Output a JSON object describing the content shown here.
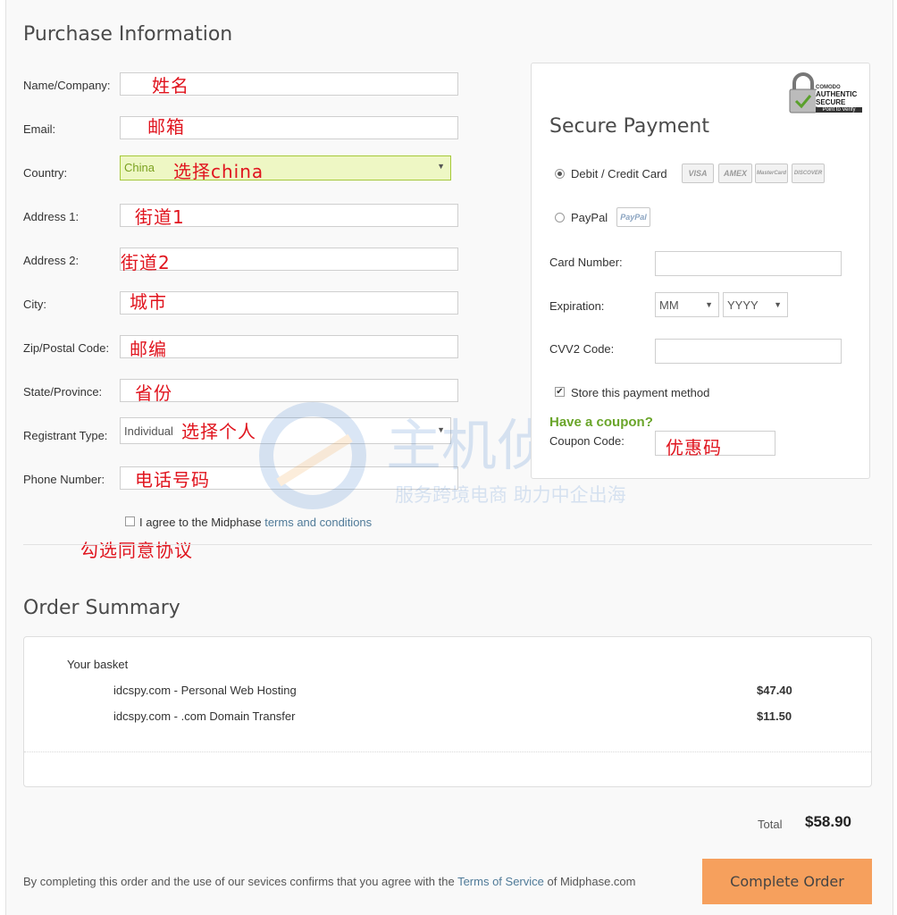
{
  "purchase": {
    "title": "Purchase Information",
    "fields": [
      {
        "label": "Name/Company:",
        "note": "姓名"
      },
      {
        "label": "Email:",
        "note": "邮箱"
      },
      {
        "label": "Country:",
        "value": "China",
        "note": "选择china"
      },
      {
        "label": "Address 1:",
        "note": "街道1"
      },
      {
        "label": "Address 2:",
        "note": "街道2"
      },
      {
        "label": "City:",
        "note": "城市"
      },
      {
        "label": "Zip/Postal Code:",
        "note": "邮编"
      },
      {
        "label": "State/Province:",
        "note": "省份"
      },
      {
        "label": "Registrant Type:",
        "value": "Individual",
        "note": "选择个人"
      },
      {
        "label": "Phone Number:",
        "note": "电话号码"
      }
    ],
    "agree_text": "I agree to the Midphase ",
    "agree_link": "terms and conditions",
    "agree_note": "勾选同意协议"
  },
  "payment": {
    "badge_top": "COMODO",
    "badge_main": "AUTHENTIC SECURE",
    "badge_sub": "Point to Verify",
    "title": "Secure Payment",
    "option_card": "Debit / Credit Card",
    "card_logos": [
      "VISA",
      "AMEX",
      "MasterCard",
      "DISCOVER"
    ],
    "option_paypal": "PayPal",
    "paypal_logo": "PayPal",
    "card_number_label": "Card Number:",
    "expiration_label": "Expiration:",
    "exp_month": "MM",
    "exp_year": "YYYY",
    "cvv_label": "CVV2 Code:",
    "store_label": "Store this payment method",
    "coupon_heading": "Have a coupon?",
    "coupon_label": "Coupon Code:",
    "coupon_note": "优惠码"
  },
  "watermark": {
    "brand": "主机侦探",
    "slogan": "服务跨境电商 助力中企出海"
  },
  "summary": {
    "title": "Order Summary",
    "basket_label": "Your basket",
    "items": [
      {
        "name": "idcspy.com - Personal Web Hosting",
        "price": "$47.40"
      },
      {
        "name": "idcspy.com - .com Domain Transfer",
        "price": "$11.50"
      }
    ],
    "total_label": "Total",
    "total_value": "$58.90"
  },
  "footer": {
    "text_before": "By completing this order and the use of our sevices confirms that you agree with the ",
    "tos_link": "Terms of Service",
    "text_after": " of Midphase.com",
    "button": "Complete Order"
  }
}
